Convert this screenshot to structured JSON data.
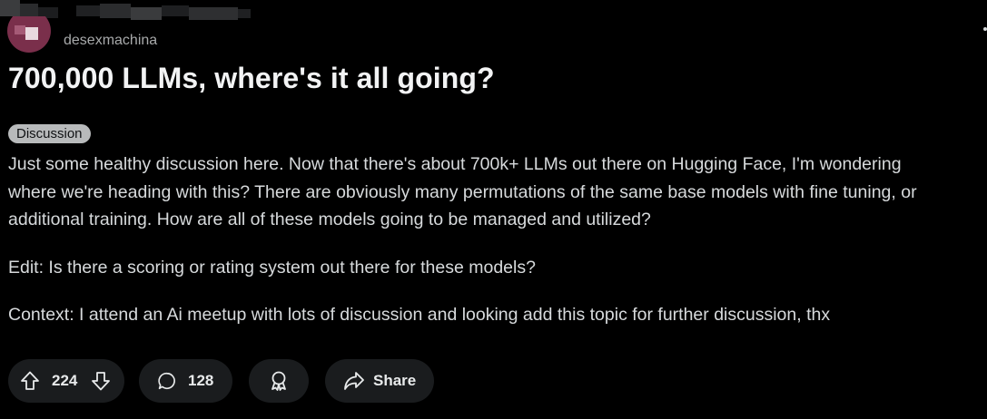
{
  "post": {
    "author": "desexmachina",
    "title": "700,000 LLMs, where's it all going?",
    "flair": "Discussion",
    "body": [
      "Just some healthy discussion here. Now that there's about 700k+ LLMs out there on Hugging Face, I'm wondering",
      "where we're heading with this? There are obviously many permutations of the same base models with fine tuning, or",
      "additional training. How are all of these models going to be managed and utilized?",
      "Edit: Is there a scoring or rating system out there for these models?",
      "Context: I attend an Ai meetup with lots of discussion and looking add this topic for further discussion, thx"
    ]
  },
  "actions": {
    "votes": "224",
    "comments": "128",
    "share_label": "Share"
  },
  "icons": {
    "upvote": "arrow-up-icon",
    "downvote": "arrow-down-icon",
    "comments": "speech-bubble-icon",
    "award": "award-ribbon-icon",
    "share": "share-arrow-icon"
  },
  "colors": {
    "background": "#000000",
    "text": "#d7dadc",
    "title": "#f2f3f4",
    "pill": "#1a1c1e",
    "flair": "#b8babb",
    "avatar": "#7a2f4b"
  }
}
